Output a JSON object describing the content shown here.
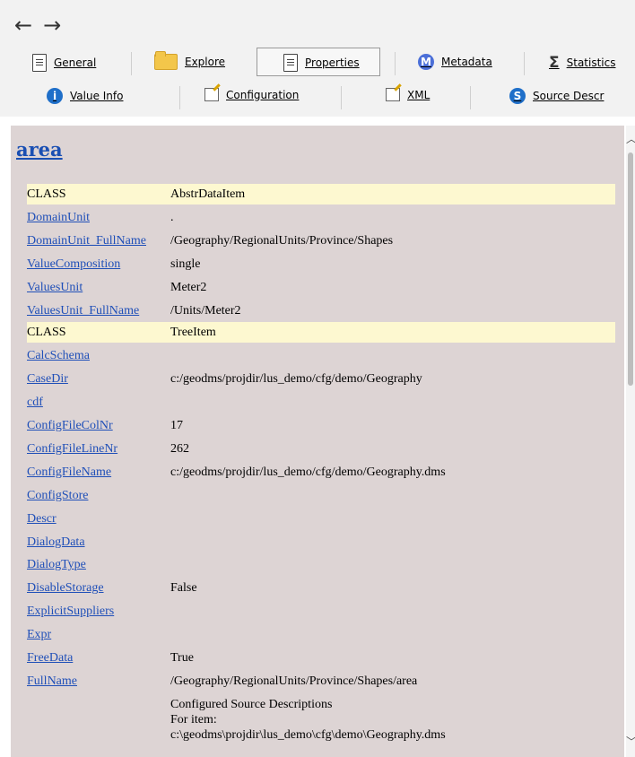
{
  "nav": {
    "back": "←",
    "forward": "→"
  },
  "toolbar": {
    "row1": [
      {
        "label": "General",
        "icon": "document-icon"
      },
      {
        "label": "Explore",
        "icon": "folder-icon"
      },
      {
        "label": "Properties",
        "icon": "document-icon"
      },
      {
        "label": "Metadata",
        "icon": "m-circle-icon"
      },
      {
        "label": "Statistics",
        "icon": "sigma-icon"
      }
    ],
    "row2": [
      {
        "label": "Value Info",
        "icon": "info-icon"
      },
      {
        "label": "Configuration",
        "icon": "edit-icon"
      },
      {
        "label": "XML",
        "icon": "edit-icon"
      },
      {
        "label": "Source Descr",
        "icon": "s-circle-icon"
      }
    ],
    "metadata_letter": "M",
    "source_letter": "S",
    "info_letter": "i",
    "sigma": "Σ"
  },
  "item": {
    "title": "area"
  },
  "properties": [
    {
      "key": "CLASS",
      "value": "AbstrDataItem",
      "class_row": true
    },
    {
      "key": "DomainUnit",
      "value": "."
    },
    {
      "key": "DomainUnit_FullName",
      "value": "/Geography/RegionalUnits/Province/Shapes"
    },
    {
      "key": "ValueComposition",
      "value": "single"
    },
    {
      "key": "ValuesUnit",
      "value": "Meter2"
    },
    {
      "key": "ValuesUnit_FullName",
      "value": "/Units/Meter2"
    },
    {
      "key": "CLASS",
      "value": "TreeItem",
      "class_row": true
    },
    {
      "key": "CalcSchema",
      "value": ""
    },
    {
      "key": "CaseDir",
      "value": "c:/geodms/projdir/lus_demo/cfg/demo/Geography"
    },
    {
      "key": "cdf",
      "value": ""
    },
    {
      "key": "ConfigFileColNr",
      "value": "17"
    },
    {
      "key": "ConfigFileLineNr",
      "value": "262"
    },
    {
      "key": "ConfigFileName",
      "value": "c:/geodms/projdir/lus_demo/cfg/demo/Geography.dms"
    },
    {
      "key": "ConfigStore",
      "value": ""
    },
    {
      "key": "Descr",
      "value": ""
    },
    {
      "key": "DialogData",
      "value": ""
    },
    {
      "key": "DialogType",
      "value": ""
    },
    {
      "key": "DisableStorage",
      "value": "False"
    },
    {
      "key": "ExplicitSuppliers",
      "value": ""
    },
    {
      "key": "Expr",
      "value": ""
    },
    {
      "key": "FreeData",
      "value": "True"
    },
    {
      "key": "FullName",
      "value": "/Geography/RegionalUnits/Province/Shapes/area"
    }
  ],
  "source_descr": {
    "line1": "Configured Source Descriptions",
    "line2": "For item:",
    "line3": "c:\\geodms\\projdir\\lus_demo\\cfg\\demo\\Geography.dms"
  }
}
